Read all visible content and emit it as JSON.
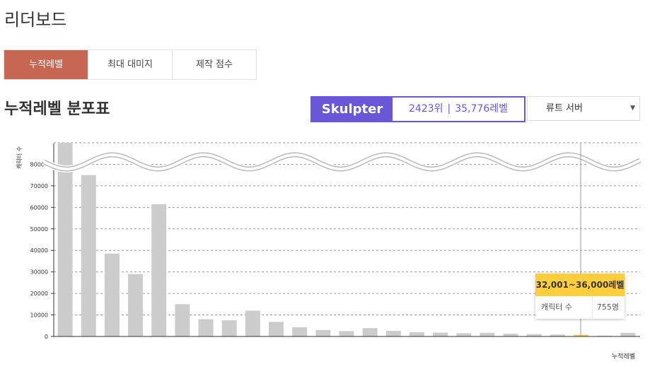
{
  "page": {
    "title": "리더보드"
  },
  "tabs": [
    {
      "label": "누적레벨",
      "active": true
    },
    {
      "label": "최대 대미지",
      "active": false
    },
    {
      "label": "제작 점수",
      "active": false
    }
  ],
  "section": {
    "title": "누적레벨 분포표"
  },
  "character": {
    "name": "Skulpter",
    "rank": "2423위",
    "level": "35,776레벨"
  },
  "server_select": {
    "value": "류트 서버"
  },
  "colors": {
    "accent_tab": "#c86654",
    "character_purple": "#6a56d8",
    "highlight_bar": "#ffc53d",
    "bar": "#cccccc"
  },
  "tooltip": {
    "range": "32,001~36,000레벨",
    "label": "캐릭터 수",
    "value": "755명"
  },
  "chart_data": {
    "type": "bar",
    "xlabel": "누적레벨",
    "ylabel": "캐릭터 수",
    "ylim": [
      0,
      90000
    ],
    "yticks": [
      0,
      10000,
      20000,
      30000,
      40000,
      50000,
      60000,
      70000,
      80000
    ],
    "axis_break": true,
    "grid": true,
    "values": [
      90000,
      75000,
      38500,
      29000,
      61500,
      15000,
      8000,
      7500,
      12000,
      6800,
      4300,
      3000,
      2500,
      3900,
      2600,
      2000,
      1800,
      1500,
      1700,
      1300,
      1100,
      900,
      755,
      400,
      1700
    ],
    "highlight_index": 22
  }
}
